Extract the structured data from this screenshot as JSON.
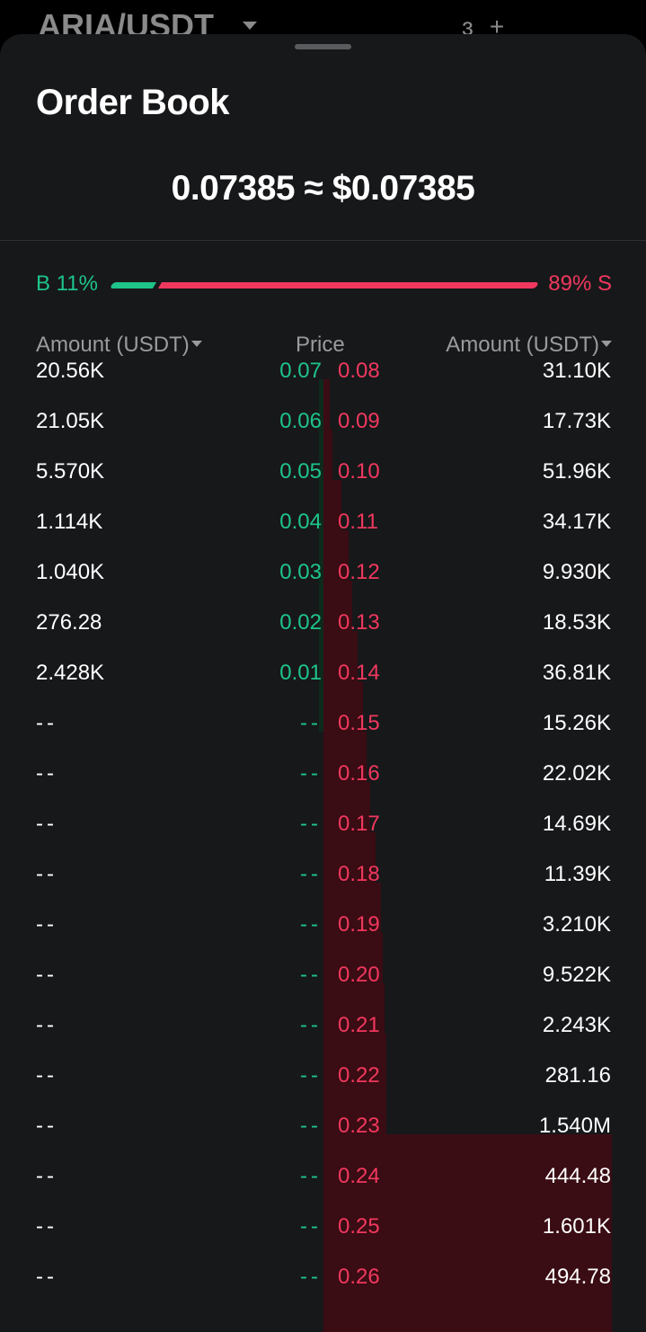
{
  "background": {
    "pair": "ARIA/USDT",
    "icons": [
      "candlestick-icon",
      "add-icon"
    ]
  },
  "sheet": {
    "title": "Order Book",
    "last_price": "0.07385 ≈ $0.07385"
  },
  "ratio": {
    "buy_label": "B 11%",
    "sell_label": "89% S",
    "buy_percent": 11,
    "sell_percent": 89
  },
  "columns": {
    "left": "Amount (USDT)",
    "middle": "Price",
    "right": "Amount (USDT)"
  },
  "colors": {
    "buy": "#1ec48a",
    "sell": "#f0385e",
    "sheet_bg": "#17181a"
  },
  "rows": [
    {
      "bid_amount": "20.56K",
      "bid_price": "0.07",
      "ask_price": "0.08",
      "ask_amount": "31.10K"
    },
    {
      "bid_amount": "21.05K",
      "bid_price": "0.06",
      "ask_price": "0.09",
      "ask_amount": "17.73K"
    },
    {
      "bid_amount": "5.570K",
      "bid_price": "0.05",
      "ask_price": "0.10",
      "ask_amount": "51.96K"
    },
    {
      "bid_amount": "1.114K",
      "bid_price": "0.04",
      "ask_price": "0.11",
      "ask_amount": "34.17K"
    },
    {
      "bid_amount": "1.040K",
      "bid_price": "0.03",
      "ask_price": "0.12",
      "ask_amount": "9.930K"
    },
    {
      "bid_amount": "276.28",
      "bid_price": "0.02",
      "ask_price": "0.13",
      "ask_amount": "18.53K"
    },
    {
      "bid_amount": "2.428K",
      "bid_price": "0.01",
      "ask_price": "0.14",
      "ask_amount": "36.81K"
    },
    {
      "bid_amount": "--",
      "bid_price": "--",
      "ask_price": "0.15",
      "ask_amount": "15.26K"
    },
    {
      "bid_amount": "--",
      "bid_price": "--",
      "ask_price": "0.16",
      "ask_amount": "22.02K"
    },
    {
      "bid_amount": "--",
      "bid_price": "--",
      "ask_price": "0.17",
      "ask_amount": "14.69K"
    },
    {
      "bid_amount": "--",
      "bid_price": "--",
      "ask_price": "0.18",
      "ask_amount": "11.39K"
    },
    {
      "bid_amount": "--",
      "bid_price": "--",
      "ask_price": "0.19",
      "ask_amount": "3.210K"
    },
    {
      "bid_amount": "--",
      "bid_price": "--",
      "ask_price": "0.20",
      "ask_amount": "9.522K"
    },
    {
      "bid_amount": "--",
      "bid_price": "--",
      "ask_price": "0.21",
      "ask_amount": "2.243K"
    },
    {
      "bid_amount": "--",
      "bid_price": "--",
      "ask_price": "0.22",
      "ask_amount": "281.16"
    },
    {
      "bid_amount": "--",
      "bid_price": "--",
      "ask_price": "0.23",
      "ask_amount": "1.540M"
    },
    {
      "bid_amount": "--",
      "bid_price": "--",
      "ask_price": "0.24",
      "ask_amount": "444.48"
    },
    {
      "bid_amount": "--",
      "bid_price": "--",
      "ask_price": "0.25",
      "ask_amount": "1.601K"
    },
    {
      "bid_amount": "--",
      "bid_price": "--",
      "ask_price": "0.26",
      "ask_amount": "494.78"
    }
  ]
}
